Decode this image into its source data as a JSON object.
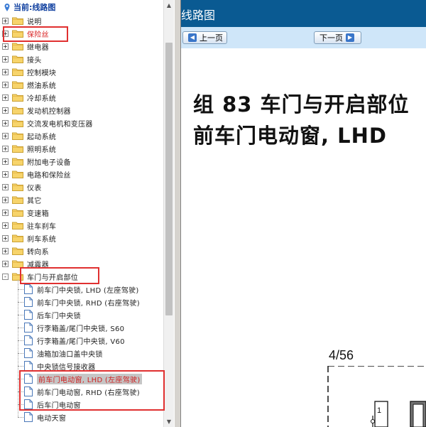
{
  "tree": {
    "header": "当前:线路图",
    "items": [
      {
        "label": "说明",
        "type": "folder",
        "exp": "+"
      },
      {
        "label": "保险丝",
        "type": "folder",
        "exp": "+",
        "red": true
      },
      {
        "label": "继电器",
        "type": "folder",
        "exp": "+"
      },
      {
        "label": "接头",
        "type": "folder",
        "exp": "+"
      },
      {
        "label": "控制模块",
        "type": "folder",
        "exp": "+"
      },
      {
        "label": "燃油系统",
        "type": "folder",
        "exp": "+"
      },
      {
        "label": "冷却系统",
        "type": "folder",
        "exp": "+"
      },
      {
        "label": "发动机控制器",
        "type": "folder",
        "exp": "+"
      },
      {
        "label": "交流发电机和变压器",
        "type": "folder",
        "exp": "+"
      },
      {
        "label": "起动系统",
        "type": "folder",
        "exp": "+"
      },
      {
        "label": "照明系统",
        "type": "folder",
        "exp": "+"
      },
      {
        "label": "附加电子设备",
        "type": "folder",
        "exp": "+"
      },
      {
        "label": "电路和保险丝",
        "type": "folder",
        "exp": "+"
      },
      {
        "label": "仪表",
        "type": "folder",
        "exp": "+"
      },
      {
        "label": "其它",
        "type": "folder",
        "exp": "+"
      },
      {
        "label": "变速箱",
        "type": "folder",
        "exp": "+"
      },
      {
        "label": "驻车刹车",
        "type": "folder",
        "exp": "+"
      },
      {
        "label": "刹车系统",
        "type": "folder",
        "exp": "+"
      },
      {
        "label": "转向系",
        "type": "folder",
        "exp": "+"
      },
      {
        "label": "减震器",
        "type": "folder",
        "exp": "+"
      },
      {
        "label": "车门与开启部位",
        "type": "folder",
        "exp": "-"
      },
      {
        "label": "前车门中央锁, LHD (左座驾驶)",
        "type": "doc"
      },
      {
        "label": "前车门中央锁, RHD (右座驾驶)",
        "type": "doc"
      },
      {
        "label": "后车门中央锁",
        "type": "doc"
      },
      {
        "label": "行李箱盖/尾门中央锁, S60",
        "type": "doc"
      },
      {
        "label": "行李箱盖/尾门中央锁, V60",
        "type": "doc"
      },
      {
        "label": "油箱加油口盖中央锁",
        "type": "doc"
      },
      {
        "label": "中央锁信号接收器",
        "type": "doc"
      },
      {
        "label": "前车门电动窗, LHD (左座驾驶)",
        "type": "doc",
        "selected": true
      },
      {
        "label": "前车门电动窗, RHD (右座驾驶)",
        "type": "doc"
      },
      {
        "label": "后车门电动窗",
        "type": "doc"
      },
      {
        "label": "电动天窗",
        "type": "doc"
      }
    ]
  },
  "viewer": {
    "title": "线路图",
    "prev_label": "上一页",
    "next_label": "下一页",
    "doc_title_line1": "组 83 车门与开启部位",
    "doc_title_line2": "前车门电动窗, LHD",
    "page_number": "4/56",
    "pin_label": "1"
  }
}
